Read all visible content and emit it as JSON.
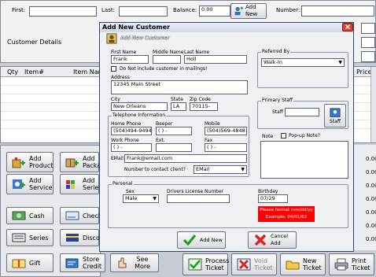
{
  "top": {
    "first_label": "First:",
    "last_label": "Last:",
    "balance_label": "Balance:",
    "balance_value": "0.00",
    "add_new_label": "Add New",
    "number_label": "Number:",
    "customer_details": "Customer Details"
  },
  "grid": {
    "columns": [
      "Qty",
      "Item#",
      "Item Nam",
      "Price"
    ]
  },
  "totals": [
    "0.00",
    "0.00",
    "0.00",
    "0.00",
    "0.00",
    "0.00",
    "0.00"
  ],
  "left_buttons": [
    {
      "label": "Add Product",
      "icon": "add-product-icon"
    },
    {
      "label": "Add Packa",
      "icon": "add-package-icon"
    },
    {
      "label": "Add Service",
      "icon": "add-service-icon"
    },
    {
      "label": "Add Series",
      "icon": "add-series-icon"
    },
    {
      "label": "Cash",
      "icon": "cash-icon"
    },
    {
      "label": "Check",
      "icon": "check-icon"
    },
    {
      "label": "Series",
      "icon": "series-icon"
    },
    {
      "label": "Discou",
      "icon": "discount-icon"
    },
    {
      "label": "Gift",
      "icon": "gift-icon"
    },
    {
      "label": "Store Credit",
      "icon": "store-credit-icon"
    },
    {
      "label": "See More",
      "icon": "see-more-icon"
    }
  ],
  "bottom_buttons": [
    {
      "label": "Process Ticket",
      "icon": "process-ticket-icon"
    },
    {
      "label": "Void Ticket",
      "icon": "void-ticket-icon"
    },
    {
      "label": "New Ticket",
      "icon": "new-ticket-icon"
    },
    {
      "label": "Print Ticket",
      "icon": "print-ticket-icon"
    }
  ],
  "dialog": {
    "title": "Add New Customer",
    "header": "Add New Customer",
    "first_name_label": "First Name",
    "first_name": "Frank",
    "middle_name_label": "Middle Name",
    "middle_name": "",
    "last_name_label": "Last Name",
    "last_name": "Holl",
    "mailings_label": "Do Not include customer in mailings!",
    "address_label": "Address",
    "address": "12345 Main Street",
    "city_label": "City",
    "city": "New Orleans",
    "state_label": "State",
    "state": "LA",
    "zip_label": "Zip Code",
    "zip": "70115-",
    "telephone_legend": "Telephone Information",
    "home_phone_label": "Home Phone",
    "home_phone": "(504)494-9494",
    "beeper_label": "Beeper",
    "beeper": "(   )   -",
    "mobile_label": "Mobile",
    "mobile": "(504)569-4848",
    "work_phone_label": "Work Phone",
    "work_phone": "(   )   -",
    "ext_label": "Ext.",
    "ext": "",
    "fax_label": "Fax",
    "fax": "(   )   -",
    "email_label": "EMail",
    "email": "Frank@email.com",
    "contact_label": "Number to contact client?",
    "contact_value": "EMail",
    "referred_legend": "Referred By",
    "referred_value": "Walk-In",
    "staff_legend": "Primary Staff",
    "staff_label": "Staff",
    "staff_button": "Staff",
    "note_label": "Note",
    "popup_label": "Pop-up Note?",
    "personal_legend": "Personal",
    "sex_label": "Sex",
    "sex_value": "Male",
    "license_label": "Drivers License Number",
    "license_value": "",
    "birthday_label": "Birthday",
    "birthday_value": "07/29",
    "birthday_hint_1": "Please format mm/dd/yy",
    "birthday_hint_2": "Example: 04/01/62",
    "add_new_button": "Add New",
    "cancel_button": "Cancel Add"
  },
  "colors": {
    "accent_red": "#ff0000",
    "close_red": "#d9432e",
    "dialog_border": "#2c4a78"
  }
}
